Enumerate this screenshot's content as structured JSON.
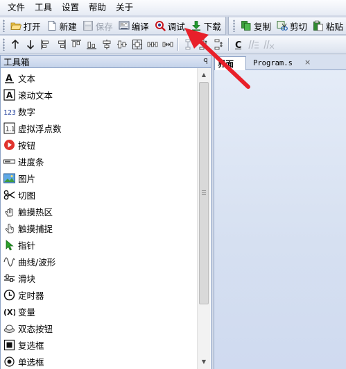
{
  "menu": [
    "文件",
    "工具",
    "设置",
    "帮助",
    "关于"
  ],
  "toolbar": {
    "open": "打开",
    "new": "新建",
    "save": "保存",
    "compile": "编译",
    "debug": "调试",
    "download": "下载",
    "copy": "复制",
    "cut": "剪切",
    "paste": "粘贴"
  },
  "toolbox": {
    "title": "工具箱",
    "pin": "ꟼ",
    "items": [
      {
        "label": "文本",
        "icon": "text-a-icon"
      },
      {
        "label": "滚动文本",
        "icon": "scroll-text-icon"
      },
      {
        "label": "数字",
        "icon": "number-123-icon"
      },
      {
        "label": "虚拟浮点数",
        "icon": "float-number-icon"
      },
      {
        "label": "按钮",
        "icon": "button-play-icon"
      },
      {
        "label": "进度条",
        "icon": "progress-bar-icon"
      },
      {
        "label": "图片",
        "icon": "picture-icon"
      },
      {
        "label": "切图",
        "icon": "scissors-icon"
      },
      {
        "label": "触摸热区",
        "icon": "hand-touch-icon"
      },
      {
        "label": "触摸捕捉",
        "icon": "hand-capture-icon"
      },
      {
        "label": "指针",
        "icon": "pointer-icon"
      },
      {
        "label": "曲线/波形",
        "icon": "waveform-icon"
      },
      {
        "label": "滑块",
        "icon": "slider-icon"
      },
      {
        "label": "定时器",
        "icon": "timer-icon"
      },
      {
        "label": "变量",
        "icon": "variable-icon"
      },
      {
        "label": "双态按钮",
        "icon": "dual-state-button-icon"
      },
      {
        "label": "复选框",
        "icon": "checkbox-icon"
      },
      {
        "label": "单选框",
        "icon": "radio-icon"
      }
    ]
  },
  "editor": {
    "tabs": [
      {
        "label": "界面"
      },
      {
        "label": "Program.s"
      }
    ],
    "close_glyph": "×"
  },
  "colors": {
    "arrow": "#e8202a",
    "panel_border": "#8ea3c6",
    "accent_green": "#1f8a2b",
    "accent_red": "#d32020"
  }
}
